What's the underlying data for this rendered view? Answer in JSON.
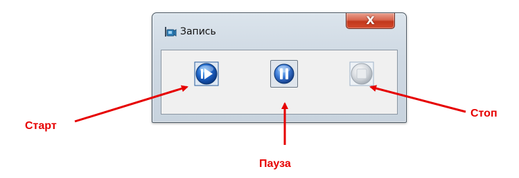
{
  "window": {
    "title": "Запись",
    "close_symbol": "X"
  },
  "icons": {
    "app": "camera-icon",
    "start": "play-circle-icon",
    "pause": "pause-circle-icon",
    "stop": "stop-circle-icon",
    "close": "close-icon"
  },
  "callouts": {
    "start": "Старт",
    "pause": "Пауза",
    "stop": "Стоп"
  },
  "colors": {
    "callout": "#e60000",
    "button_blue": "#1e63c6",
    "close_red": "#c2371c"
  }
}
